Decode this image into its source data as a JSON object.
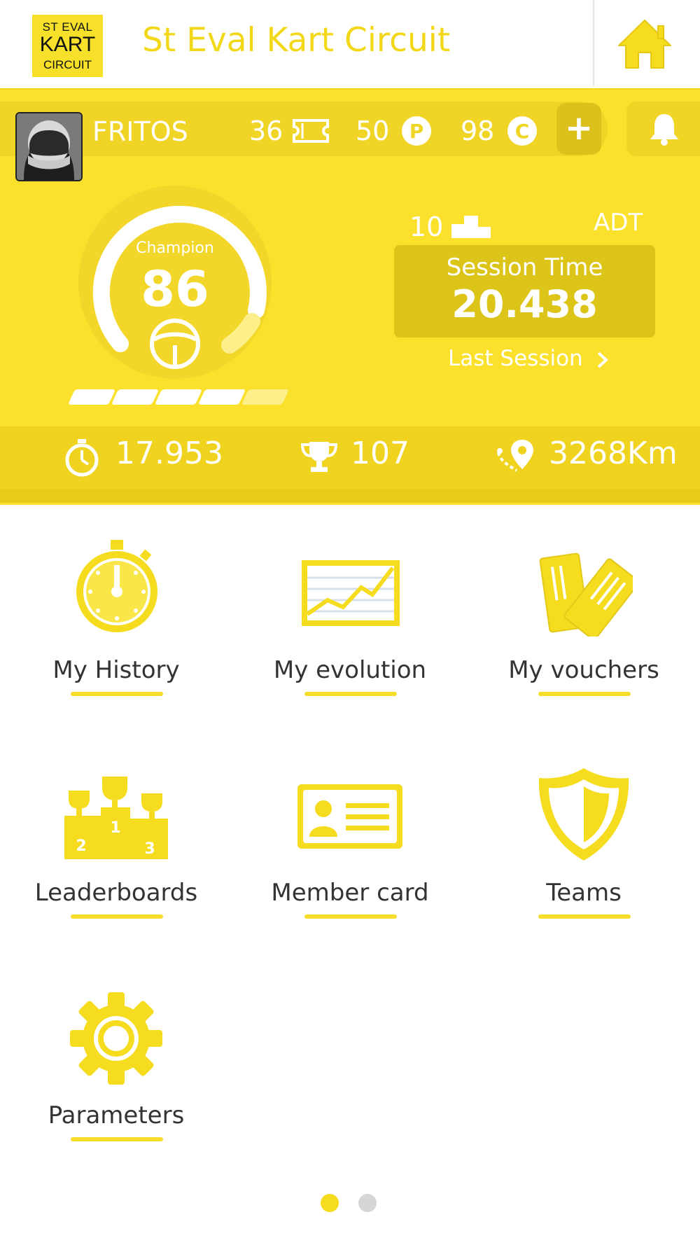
{
  "header": {
    "logo_lines": [
      "ST EVAL",
      "KART",
      "CIRCUIT"
    ],
    "title": "St Eval Kart Circuit",
    "home_icon": "home-icon"
  },
  "profile": {
    "username": "FRITOS",
    "tickets": "36",
    "points": "50",
    "credits": "98",
    "plus_label": "+",
    "level_label": "Champion",
    "level_value": "86",
    "level_progress_segments": 4,
    "level_total_segments": 5,
    "rank": "10",
    "track_code": "ADT",
    "session_time_label": "Session Time",
    "session_time_value": "20.438",
    "last_session_label": "Last Session"
  },
  "stats": {
    "best_lap": "17.953",
    "trophies": "107",
    "distance": "3268Km"
  },
  "menu": {
    "items": [
      {
        "label": "My History",
        "icon": "stopwatch-icon"
      },
      {
        "label": "My evolution",
        "icon": "line-chart-icon"
      },
      {
        "label": "My vouchers",
        "icon": "vouchers-icon"
      },
      {
        "label": "Leaderboards",
        "icon": "podium-trophies-icon"
      },
      {
        "label": "Member card",
        "icon": "member-card-icon"
      },
      {
        "label": "Teams",
        "icon": "shield-icon"
      },
      {
        "label": "Parameters",
        "icon": "gear-icon"
      }
    ]
  },
  "pagination": {
    "current": 1,
    "total": 2
  },
  "colors": {
    "brand_yellow": "#fbe12b",
    "title_yellow": "#f2d819",
    "text_dark": "#333333"
  }
}
